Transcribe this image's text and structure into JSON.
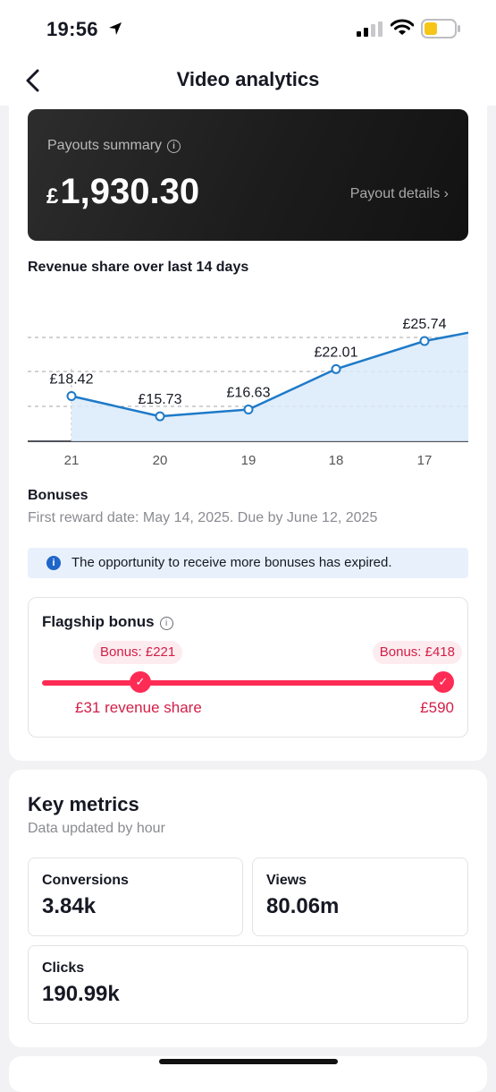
{
  "status": {
    "time": "19:56"
  },
  "nav": {
    "title": "Video analytics"
  },
  "payout": {
    "label": "Payouts summary",
    "currency": "£",
    "amount": "1,930.30",
    "details_link": "Payout details ›"
  },
  "chart_data": {
    "type": "area",
    "title": "Revenue share over last 14 days",
    "categories": [
      "21",
      "20",
      "19",
      "18",
      "17"
    ],
    "series": [
      {
        "values": [
          18.42,
          15.73,
          16.63,
          22.01,
          25.74
        ]
      }
    ],
    "data_labels": [
      "£18.42",
      "£15.73",
      "£16.63",
      "£22.01",
      "£25.74"
    ],
    "grid": true,
    "colors": {
      "line": "#1e7ac8",
      "fill": "#dbeafa"
    }
  },
  "bonuses": {
    "title": "Bonuses",
    "subtitle": "First reward date: May 14, 2025. Due by June 12, 2025",
    "notice": "The opportunity to receive more bonuses has expired."
  },
  "flagship": {
    "title": "Flagship bonus",
    "milestones": [
      {
        "bonus": "Bonus: £221",
        "threshold": "£31 revenue share",
        "completed": true
      },
      {
        "bonus": "Bonus: £418",
        "threshold": "£590",
        "completed": true
      }
    ]
  },
  "key_metrics": {
    "title": "Key metrics",
    "subtitle": "Data updated by hour",
    "items": [
      {
        "label": "Conversions",
        "value": "3.84k"
      },
      {
        "label": "Views",
        "value": "80.06m"
      },
      {
        "label": "Clicks",
        "value": "190.99k"
      }
    ]
  },
  "colors": {
    "accent": "#fe2c55",
    "info": "#1f66c9"
  }
}
